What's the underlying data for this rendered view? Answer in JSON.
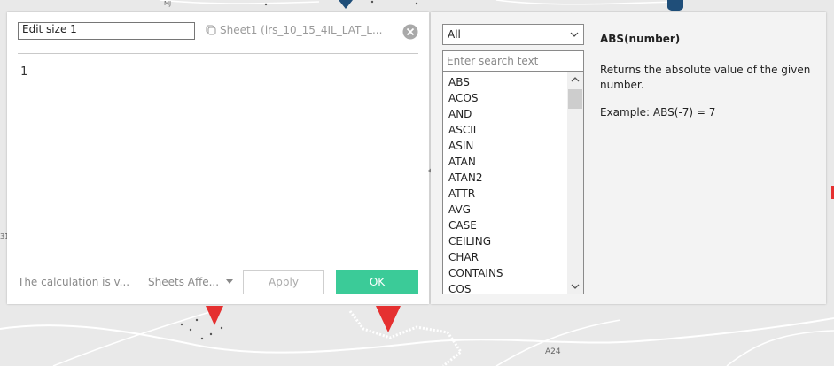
{
  "map": {
    "road_label": "A24",
    "edge_label_left": "31",
    "edge_label_top": "MJ"
  },
  "editor": {
    "name_value": "Edit size 1",
    "sheet_ref": "Sheet1 (irs_10_15_4IL_LAT_L...",
    "formula": "1",
    "status": "The calculation is v...",
    "sheets_affected": "Sheets Affe...",
    "apply_label": "Apply",
    "ok_label": "OK",
    "ok_color": "#3bcb98"
  },
  "functions": {
    "category": "All",
    "search_placeholder": "Enter search text",
    "items": [
      "ABS",
      "ACOS",
      "AND",
      "ASCII",
      "ASIN",
      "ATAN",
      "ATAN2",
      "ATTR",
      "AVG",
      "CASE",
      "CEILING",
      "CHAR",
      "CONTAINS",
      "COS"
    ]
  },
  "help": {
    "title": "ABS(number)",
    "description": "Returns the absolute value of the given number.",
    "example": "Example: ABS(-7) = 7"
  }
}
